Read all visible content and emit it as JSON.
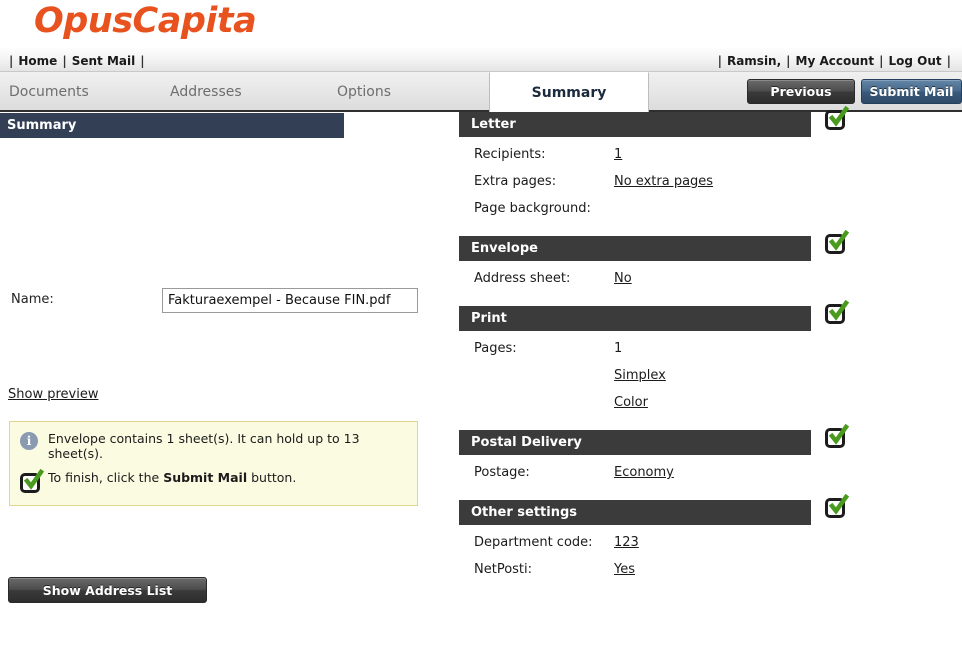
{
  "brand": {
    "logo_text": "OpusCapita",
    "logo_color": "#e8521e"
  },
  "topnav": {
    "left_items": [
      {
        "label": "Home",
        "name": "nav-home"
      },
      {
        "label": "Sent Mail",
        "name": "nav-sent-mail"
      }
    ],
    "right_items": [
      {
        "label": "Ramsin,",
        "name": "nav-username"
      },
      {
        "label": "My Account",
        "name": "nav-my-account"
      },
      {
        "label": "Log Out",
        "name": "nav-log-out"
      }
    ],
    "separator": "|"
  },
  "tabs": [
    {
      "label": "Documents",
      "active": false
    },
    {
      "label": "Addresses",
      "active": false
    },
    {
      "label": "Options",
      "active": false
    },
    {
      "label": "Summary",
      "active": true
    }
  ],
  "toolbar": {
    "previous_label": "Previous",
    "submit_label": "Submit Mail",
    "previous_color": "#3a3a3a",
    "submit_color": "#3a5a7c"
  },
  "left_panel": {
    "header": "Summary",
    "header_color": "#333f55",
    "name_label": "Name:",
    "name_value": "Fakturaexempel - Because FIN.pdf",
    "name_placeholder": "",
    "show_preview_label": "Show preview",
    "info": {
      "messages": [
        {
          "icon": "info-icon",
          "text": "Envelope contains 1 sheet(s). It can hold up to 13 sheet(s)."
        },
        {
          "icon": "check-icon",
          "text_before": "To finish, click the ",
          "text_bold": "Submit Mail",
          "text_after": " button."
        }
      ],
      "background_color": "#fbfbe2",
      "border_color": "#e0d78a"
    },
    "address_list_button": "Show Address List"
  },
  "right_panel": {
    "header_color": "#3b3b3b",
    "check_color": "#4a9a1e",
    "sections": [
      {
        "title": "Letter",
        "status": "ok",
        "rows": [
          {
            "key": "Recipients:",
            "value": "1",
            "link": true
          },
          {
            "key": "Extra pages:",
            "value": "No extra pages",
            "link": true
          },
          {
            "key": "Page background:",
            "value": "",
            "link": false
          }
        ]
      },
      {
        "title": "Envelope",
        "status": "ok",
        "rows": [
          {
            "key": "Address sheet:",
            "value": "No",
            "link": true
          }
        ]
      },
      {
        "title": "Print",
        "status": "ok",
        "rows": [
          {
            "key": "Pages:",
            "value": "1",
            "link": false
          },
          {
            "key": "",
            "value": "Simplex",
            "link": true
          },
          {
            "key": "",
            "value": "Color",
            "link": true
          }
        ]
      },
      {
        "title": "Postal Delivery",
        "status": "ok",
        "rows": [
          {
            "key": "Postage:",
            "value": "Economy",
            "link": true
          }
        ]
      },
      {
        "title": "Other settings",
        "status": "ok",
        "rows": [
          {
            "key": "Department code:",
            "value": "123",
            "link": true
          },
          {
            "key": "NetPosti:",
            "value": "Yes",
            "link": true
          }
        ]
      }
    ]
  }
}
